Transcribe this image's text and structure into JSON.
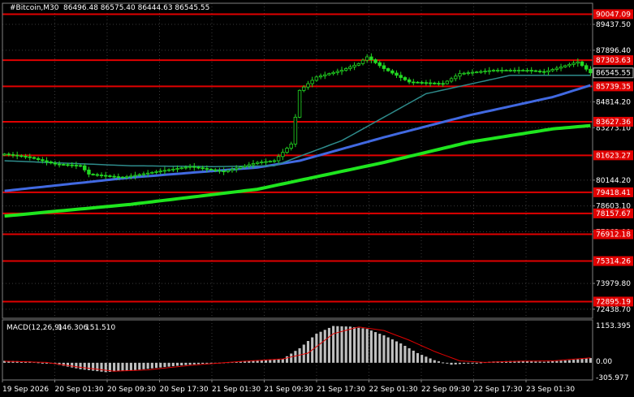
{
  "window": {
    "symbol_title": "#Bitcoin,M30",
    "ohlc": "86496.48 86575.40 86444.63 86545.55"
  },
  "macd": {
    "label": "MACD(12,26,9)",
    "main_value": "146.306",
    "signal_value": "151.510",
    "axis_labels": [
      "1153.395",
      "0.00",
      "-305.977"
    ]
  },
  "price_axis_labels": [
    "89437.50",
    "87896.40",
    "84814.20",
    "83273.10",
    "80144.20",
    "78603.10",
    "77062.00",
    "73979.80",
    "72438.70"
  ],
  "current_price": "86545.55",
  "level_labels": [
    "90047.09",
    "87303.63",
    "85739.35",
    "83627.36",
    "81623.27",
    "79418.41",
    "78157.67",
    "76912.18",
    "75314.26",
    "72895.19"
  ],
  "time_labels": [
    "19 Sep 2026",
    "20 Sep 01:30",
    "20 Sep 09:30",
    "20 Sep 17:30",
    "21 Sep 01:30",
    "21 Sep 09:30",
    "21 Sep 17:30",
    "22 Sep 01:30",
    "22 Sep 09:30",
    "22 Sep 17:30",
    "23 Sep 01:30"
  ],
  "colors": {
    "background": "#000000",
    "grid": "#3a3a3a",
    "level_line": "#e00000",
    "level_label_bg": "#e00000",
    "candle": "#22d922",
    "ma_fast": "#2e8b8b",
    "ma_mid": "#4169e1",
    "ma_slow": "#1ee61e",
    "macd_hist": "#c0c0c0",
    "macd_signal": "#e00000",
    "text": "#ffffff"
  },
  "chart_data": {
    "type": "line",
    "price_range": [
      71900,
      90700
    ],
    "levels": [
      90047.09,
      87303.63,
      85739.35,
      83627.36,
      81623.27,
      79418.41,
      78157.67,
      76912.18,
      75314.26,
      72895.19
    ],
    "price_bar_count": 140,
    "close_anchors": [
      [
        0,
        81700
      ],
      [
        6,
        81500
      ],
      [
        12,
        81100
      ],
      [
        18,
        81000
      ],
      [
        20,
        80500
      ],
      [
        28,
        80300
      ],
      [
        36,
        80650
      ],
      [
        44,
        80950
      ],
      [
        52,
        80650
      ],
      [
        60,
        81200
      ],
      [
        64,
        81300
      ],
      [
        66,
        81800
      ],
      [
        68,
        82300
      ],
      [
        70,
        85500
      ],
      [
        74,
        86300
      ],
      [
        80,
        86700
      ],
      [
        84,
        87100
      ],
      [
        86,
        87500
      ],
      [
        90,
        86800
      ],
      [
        96,
        86000
      ],
      [
        104,
        85900
      ],
      [
        108,
        86500
      ],
      [
        116,
        86700
      ],
      [
        124,
        86700
      ],
      [
        128,
        86600
      ],
      [
        132,
        86900
      ],
      [
        136,
        87200
      ],
      [
        139,
        86545.55
      ]
    ],
    "ma_fast_anchors": [
      [
        0,
        81300
      ],
      [
        30,
        81000
      ],
      [
        50,
        80950
      ],
      [
        64,
        81000
      ],
      [
        80,
        82500
      ],
      [
        100,
        85300
      ],
      [
        120,
        86400
      ],
      [
        139,
        86400
      ]
    ],
    "ma_mid_anchors": [
      [
        0,
        79500
      ],
      [
        30,
        80300
      ],
      [
        60,
        80900
      ],
      [
        70,
        81300
      ],
      [
        90,
        82700
      ],
      [
        110,
        84000
      ],
      [
        130,
        85100
      ],
      [
        139,
        85800
      ]
    ],
    "ma_slow_anchors": [
      [
        0,
        78000
      ],
      [
        30,
        78700
      ],
      [
        60,
        79600
      ],
      [
        90,
        81200
      ],
      [
        110,
        82400
      ],
      [
        130,
        83200
      ],
      [
        139,
        83400
      ]
    ],
    "macd_range": [
      -305.977,
      1153.395
    ],
    "macd_hist_anchors": [
      [
        0,
        60
      ],
      [
        6,
        40
      ],
      [
        12,
        -40
      ],
      [
        18,
        -200
      ],
      [
        24,
        -290
      ],
      [
        30,
        -240
      ],
      [
        36,
        -160
      ],
      [
        42,
        -80
      ],
      [
        48,
        -20
      ],
      [
        56,
        40
      ],
      [
        62,
        80
      ],
      [
        66,
        120
      ],
      [
        70,
        450
      ],
      [
        74,
        900
      ],
      [
        78,
        1140
      ],
      [
        82,
        1120
      ],
      [
        86,
        1050
      ],
      [
        90,
        850
      ],
      [
        94,
        600
      ],
      [
        98,
        300
      ],
      [
        102,
        80
      ],
      [
        106,
        -60
      ],
      [
        110,
        -20
      ],
      [
        116,
        40
      ],
      [
        122,
        60
      ],
      [
        128,
        30
      ],
      [
        134,
        80
      ],
      [
        139,
        146.306
      ]
    ],
    "macd_signal_anchors": [
      [
        0,
        50
      ],
      [
        10,
        10
      ],
      [
        18,
        -140
      ],
      [
        26,
        -260
      ],
      [
        34,
        -220
      ],
      [
        44,
        -80
      ],
      [
        56,
        40
      ],
      [
        66,
        120
      ],
      [
        72,
        300
      ],
      [
        78,
        900
      ],
      [
        84,
        1110
      ],
      [
        90,
        1000
      ],
      [
        96,
        700
      ],
      [
        102,
        350
      ],
      [
        108,
        60
      ],
      [
        114,
        10
      ],
      [
        122,
        50
      ],
      [
        130,
        60
      ],
      [
        139,
        151.51
      ]
    ]
  }
}
